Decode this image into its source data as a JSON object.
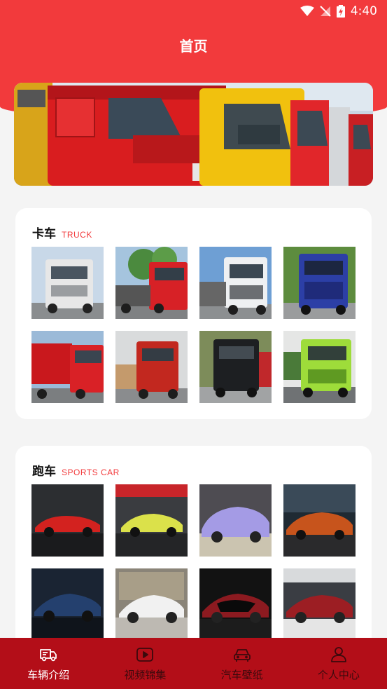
{
  "status_bar": {
    "time": "4:40"
  },
  "header": {
    "title": "首页"
  },
  "sections": [
    {
      "title": "卡车",
      "subtitle": "TRUCK",
      "items": [
        "white-truck",
        "red-truck-green-trees",
        "white-truck-blue-sky",
        "blue-truck",
        "red-cargo-truck",
        "red-tractor-truck",
        "black-truck",
        "lime-green-truck"
      ]
    },
    {
      "title": "跑车",
      "subtitle": "SPORTS CAR",
      "items": [
        "red-roadster",
        "yellow-sports-car",
        "lilac-sports-car",
        "orange-coupe",
        "blue-hypercar",
        "white-hypercar",
        "red-black-hypercar",
        "red-roadster-showroom"
      ]
    }
  ],
  "nav": [
    {
      "label": "车辆介绍",
      "icon": "truck-icon",
      "active": true
    },
    {
      "label": "视频锦集",
      "icon": "video-icon",
      "active": false
    },
    {
      "label": "汽车壁纸",
      "icon": "car-icon",
      "active": false
    },
    {
      "label": "个人中心",
      "icon": "person-icon",
      "active": false
    }
  ],
  "colors": {
    "brand": "#f23a3c",
    "nav_bg": "#b30e18",
    "nav_inactive": "#3b0a0d"
  }
}
